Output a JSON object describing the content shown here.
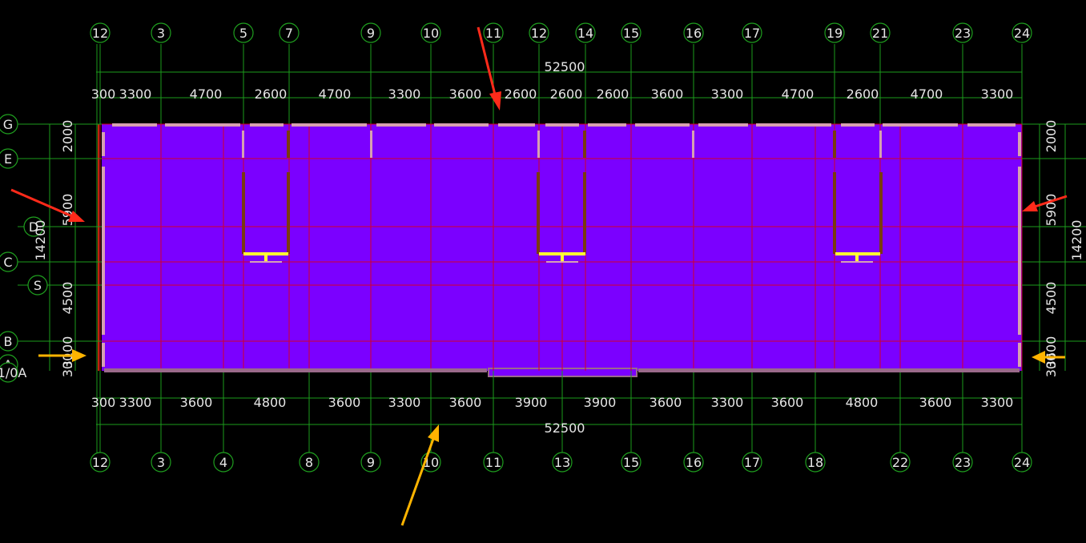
{
  "colors": {
    "background": "#000000",
    "slab": "#7b00ff",
    "grid_line": "#d0002a",
    "dim_line": "#1c9c1c",
    "axis_circle": "#1f9f1f",
    "text": "#e6e6e6",
    "wall_light": "#d8a0b0",
    "wall_dark": "#7a3a10",
    "stair": "#ffff33",
    "arrow_red": "#ff2a1a",
    "arrow_orange": "#ffb400"
  },
  "top_axes": [
    {
      "label": "12"
    },
    {
      "label": "3"
    },
    {
      "label": "5"
    },
    {
      "label": "7"
    },
    {
      "label": "9"
    },
    {
      "label": "10"
    },
    {
      "label": "11"
    },
    {
      "label": "12"
    },
    {
      "label": "14"
    },
    {
      "label": "15"
    },
    {
      "label": "16"
    },
    {
      "label": "17"
    },
    {
      "label": "19"
    },
    {
      "label": "21"
    },
    {
      "label": "23"
    },
    {
      "label": "24"
    }
  ],
  "bottom_axes": [
    {
      "label": "12"
    },
    {
      "label": "3"
    },
    {
      "label": "4"
    },
    {
      "label": "8"
    },
    {
      "label": "9"
    },
    {
      "label": "10"
    },
    {
      "label": "11"
    },
    {
      "label": "13"
    },
    {
      "label": "15"
    },
    {
      "label": "16"
    },
    {
      "label": "17"
    },
    {
      "label": "18"
    },
    {
      "label": "22"
    },
    {
      "label": "23"
    },
    {
      "label": "24"
    }
  ],
  "top_total": "52500",
  "bottom_total": "52500",
  "top_dims": [
    "300",
    "3300",
    "4700",
    "2600",
    "4700",
    "3300",
    "3600",
    "2600",
    "2600",
    "2600",
    "3600",
    "3300",
    "4700",
    "2600",
    "4700",
    "3300"
  ],
  "bottom_dims": [
    "300",
    "3300",
    "3600",
    "4800",
    "3600",
    "3300",
    "3600",
    "3900",
    "3900",
    "3600",
    "3300",
    "3600",
    "4800",
    "3600",
    "3300"
  ],
  "left_axes": [
    {
      "label": "G"
    },
    {
      "label": "E"
    },
    {
      "label": "D"
    },
    {
      "label": "C"
    },
    {
      "label": "S"
    },
    {
      "label": "B"
    },
    {
      "label": "A"
    },
    {
      "label": "1/0A"
    }
  ],
  "left_dims": [
    "2000",
    "5900",
    "4500",
    "3100",
    "300"
  ],
  "left_total": "14200",
  "right_dims": [
    "2000",
    "5900",
    "4500",
    "3600",
    "300"
  ],
  "right_total": "14200"
}
